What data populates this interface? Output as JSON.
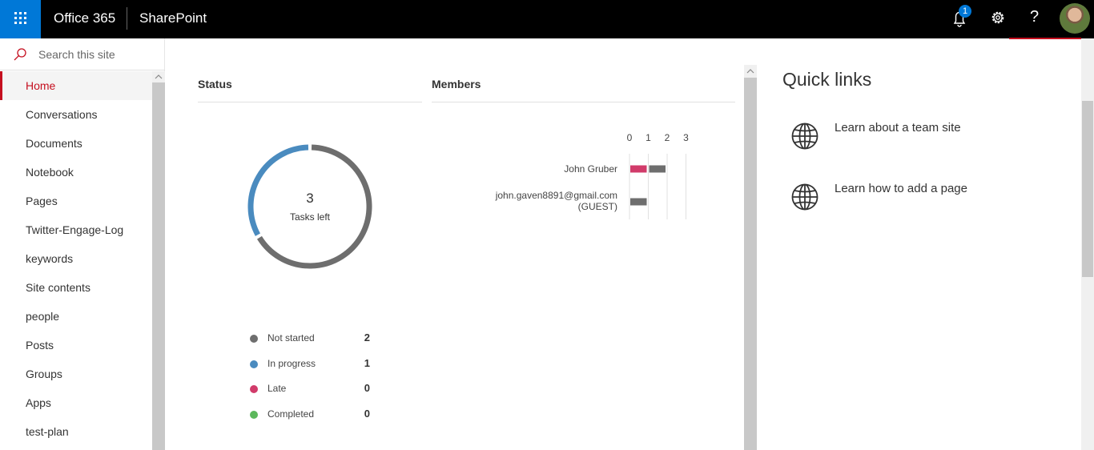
{
  "suite_bar": {
    "brand": "Office 365",
    "app_name": "SharePoint",
    "notification_count": "1",
    "help_glyph": "?",
    "colors": {
      "background": "#000000",
      "waffle": "#0078d7"
    }
  },
  "left_nav": {
    "search_placeholder": "Search this site",
    "items": [
      {
        "label": "Home",
        "active": true
      },
      {
        "label": "Conversations"
      },
      {
        "label": "Documents"
      },
      {
        "label": "Notebook"
      },
      {
        "label": "Pages"
      },
      {
        "label": "Twitter-Engage-Log"
      },
      {
        "label": "keywords"
      },
      {
        "label": "Site contents"
      },
      {
        "label": "people"
      },
      {
        "label": "Posts"
      },
      {
        "label": "Groups"
      },
      {
        "label": "Apps"
      },
      {
        "label": "test-plan"
      }
    ],
    "accent_color": "#c50f1f"
  },
  "status": {
    "title": "Status",
    "tasks_left": "3",
    "tasks_left_label": "Tasks left",
    "legend": [
      {
        "label": "Not started",
        "count": "2",
        "color": "#6e6e6e"
      },
      {
        "label": "In progress",
        "count": "1",
        "color": "#4a8bbf"
      },
      {
        "label": "Late",
        "count": "0",
        "color": "#d13b6a"
      },
      {
        "label": "Completed",
        "count": "0",
        "color": "#5cb85c"
      }
    ]
  },
  "members": {
    "title": "Members"
  },
  "chart_data": [
    {
      "type": "pie",
      "categories": [
        "Not started",
        "In progress",
        "Late",
        "Completed"
      ],
      "values": [
        2,
        1,
        0,
        0
      ],
      "title": "",
      "center_value": "3",
      "center_label": "Tasks left"
    },
    {
      "type": "bar",
      "orientation": "horizontal",
      "categories": [
        "John Gruber",
        "john.gaven8891@gmail.com (GUEST)"
      ],
      "category_lines": [
        [
          "John Gruber"
        ],
        [
          "john.gaven8891@gmail.com",
          "(GUEST)"
        ]
      ],
      "series": [
        {
          "color": "#d13b6a",
          "values": [
            1,
            0
          ]
        },
        {
          "color": "#6e6e6e",
          "values": [
            1,
            1
          ]
        }
      ],
      "x_ticks": [
        "0",
        "1",
        "2",
        "3"
      ],
      "xlim": [
        0,
        3
      ],
      "grid": true
    }
  ],
  "quick_links": {
    "title": "Quick links",
    "items": [
      {
        "label": "Learn about a team site",
        "icon": "globe-icon"
      },
      {
        "label": "Learn how to add a page",
        "icon": "globe-icon"
      }
    ]
  }
}
